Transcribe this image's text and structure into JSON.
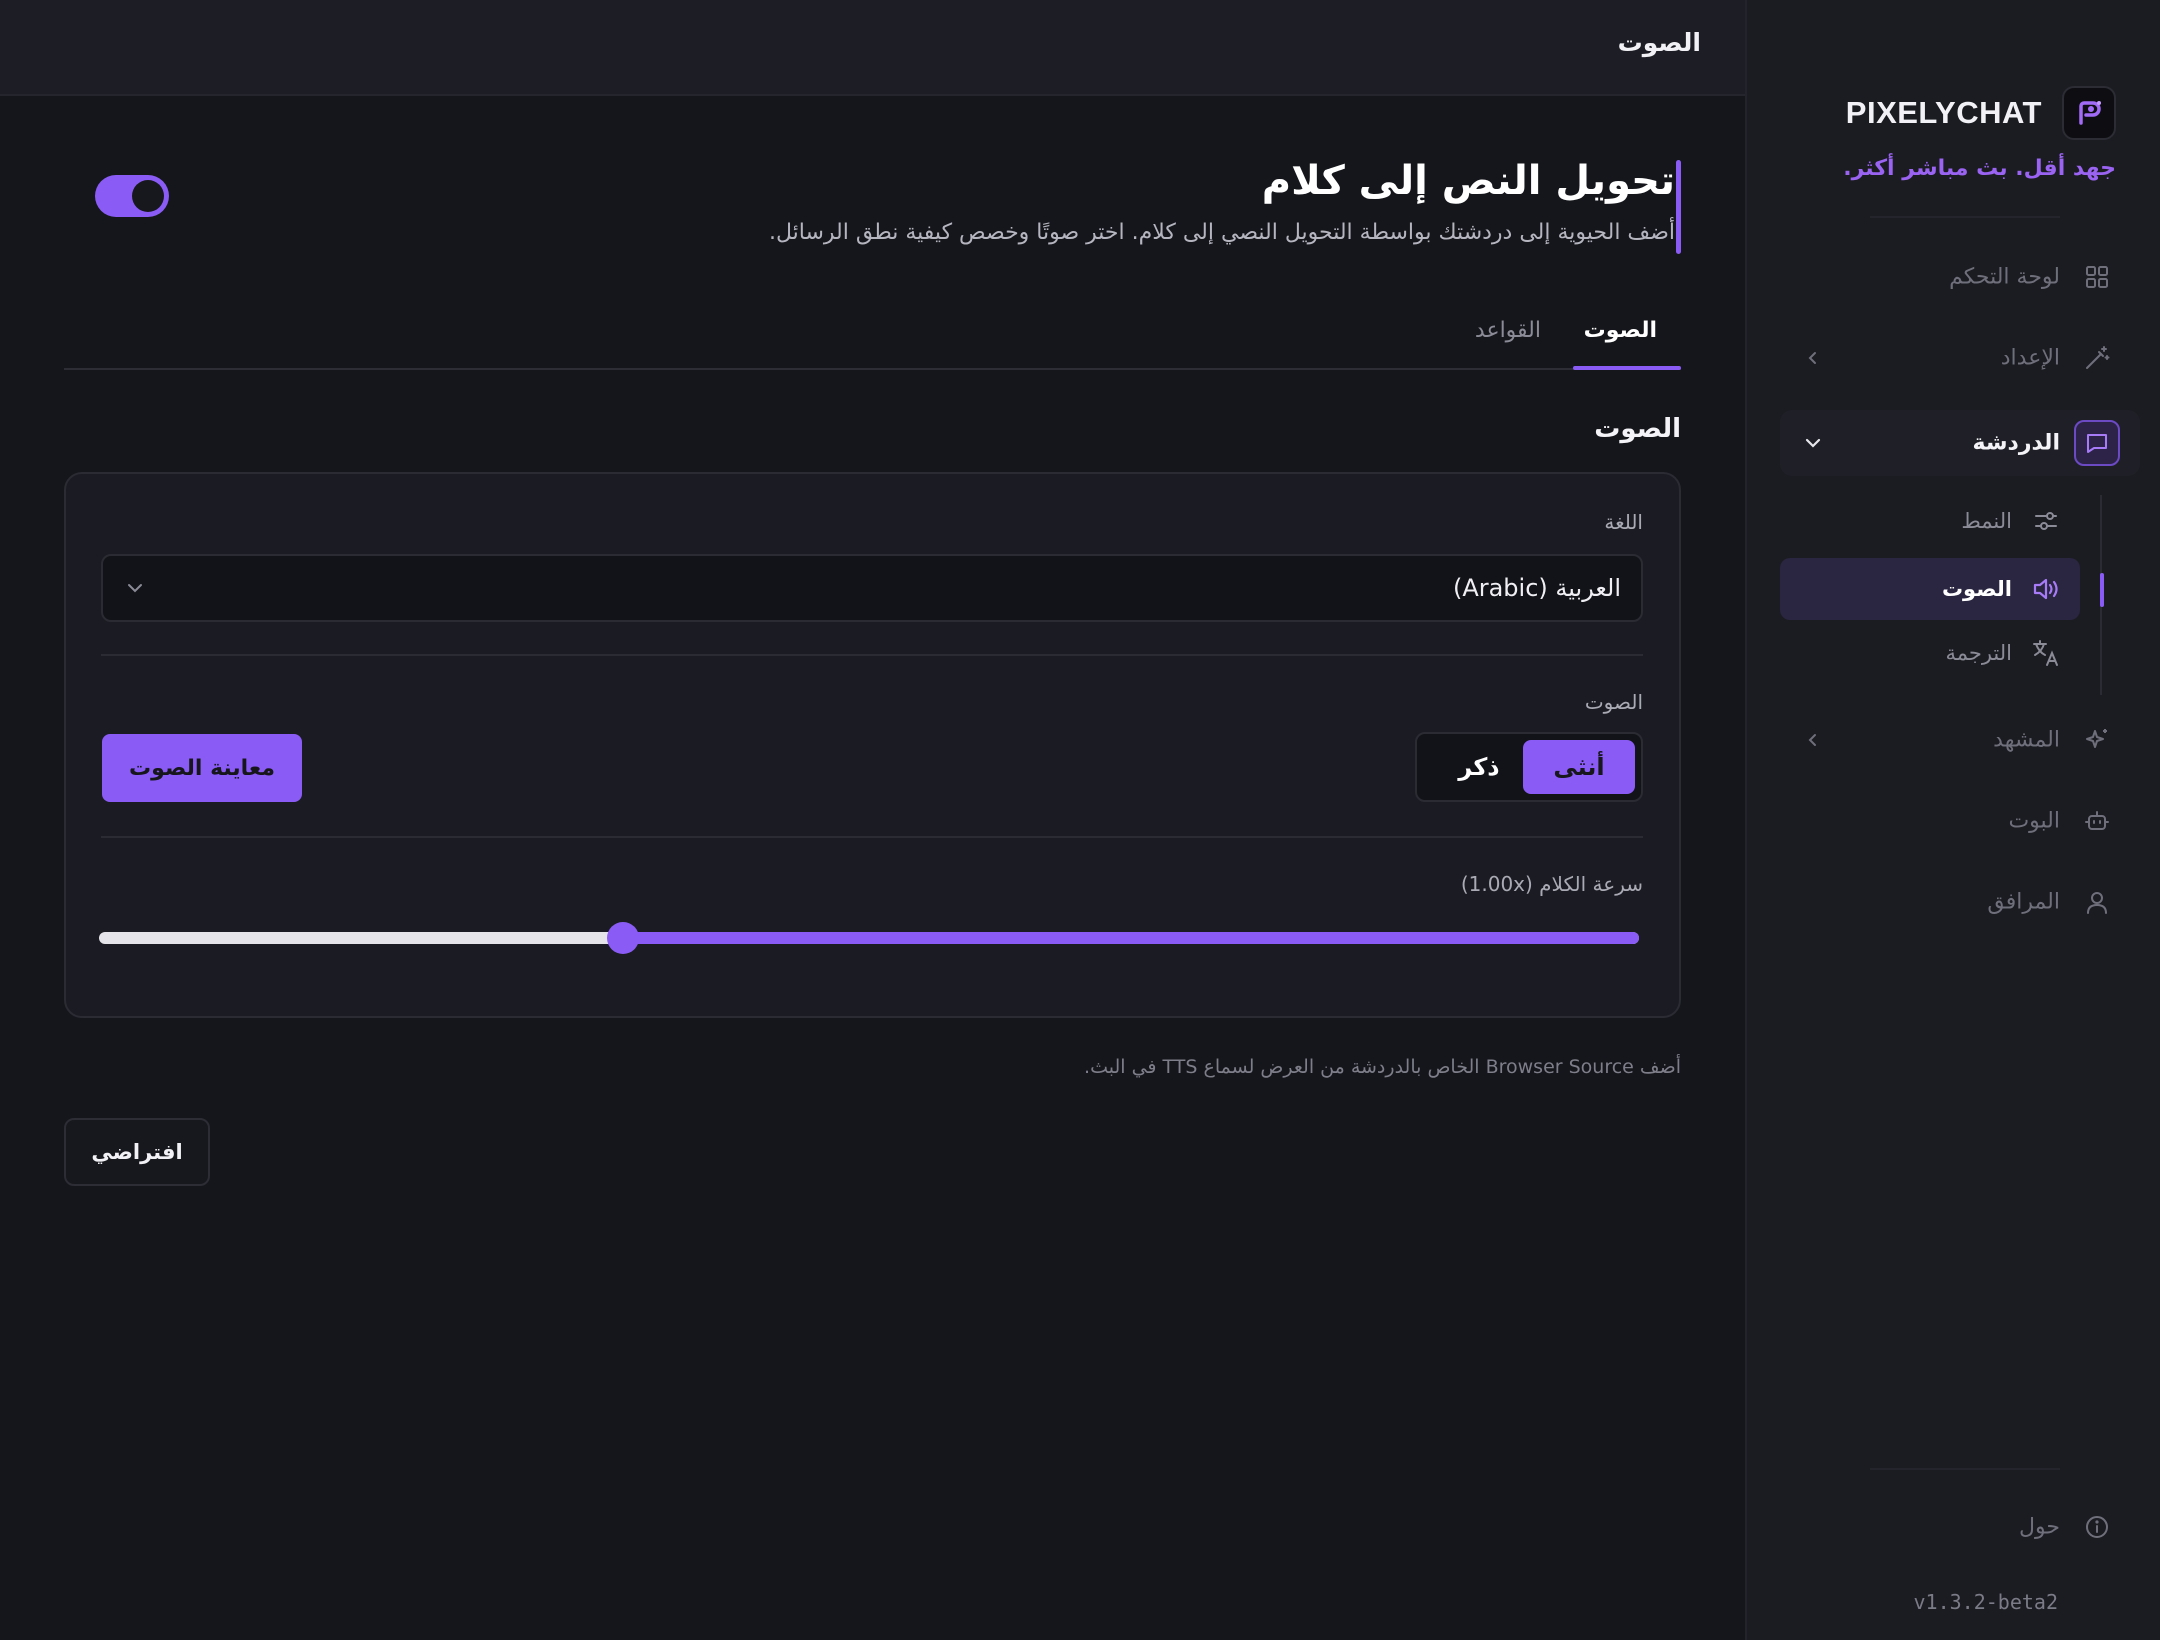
{
  "sidebar": {
    "brand_name": "PIXELYCHAT",
    "tagline": "جهد أقل. بث مباشر أكثر.",
    "items": [
      {
        "label": "لوحة التحكم",
        "icon": "grid-icon"
      },
      {
        "label": "الإعداد",
        "icon": "wand-icon"
      },
      {
        "label": "الدردشة",
        "icon": "chat-icon"
      },
      {
        "label": "المشهد",
        "icon": "sparkles-icon"
      },
      {
        "label": "البوت",
        "icon": "bot-icon"
      },
      {
        "label": "المرافق",
        "icon": "user-icon"
      }
    ],
    "chat_sub_items": [
      {
        "label": "النمط",
        "icon": "sliders-icon"
      },
      {
        "label": "الصوت",
        "icon": "speaker-icon"
      },
      {
        "label": "الترجمة",
        "icon": "translate-icon"
      }
    ],
    "about_label": "حول",
    "version": "v1.3.2-beta2",
    "accent": "#8a5cf5"
  },
  "topbar": {
    "title": "الصوت"
  },
  "hero": {
    "title": "تحويل النص إلى كلام",
    "description": "أضف الحيوية إلى دردشتك بواسطة التحويل النصي إلى كلام. اختر صوتًا وخصص كيفية نطق الرسائل.",
    "enabled": true
  },
  "tabs": [
    {
      "label": "الصوت",
      "active": true
    },
    {
      "label": "القواعد",
      "active": false
    }
  ],
  "section": {
    "title": "الصوت",
    "language_label": "اللغة",
    "language_value": "العربية (Arabic)",
    "voice_label": "الصوت",
    "voice_options": [
      "أنثى",
      "ذكر"
    ],
    "voice_selected": "أنثى",
    "preview_label": "معاينة الصوت",
    "speed_label": "سرعة الكلام (1.00x)",
    "speed_fraction": 0.34
  },
  "hint": "أضف Browser Source الخاص بالدردشة من العرض لسماع TTS في البث.",
  "default_label": "افتراضي"
}
